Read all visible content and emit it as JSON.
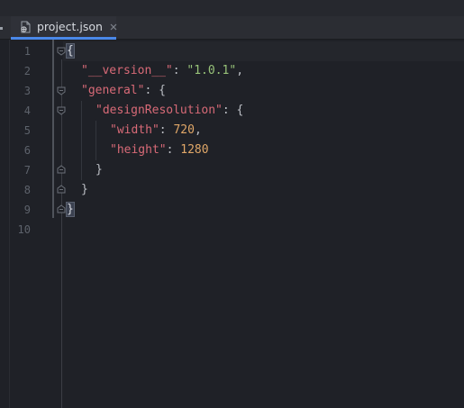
{
  "tab": {
    "icon": "json-file-icon",
    "label": "project.json",
    "close_icon": "close-icon"
  },
  "accent": "#4a88e8",
  "line_numbers": [
    "1",
    "2",
    "3",
    "4",
    "5",
    "6",
    "7",
    "8",
    "9",
    "10"
  ],
  "code": {
    "l1": {
      "brace": "{"
    },
    "l2": {
      "key": "\"__version__\"",
      "colon": ": ",
      "value": "\"1.0.1\"",
      "comma": ","
    },
    "l3": {
      "key": "\"general\"",
      "colon": ": ",
      "brace": "{"
    },
    "l4": {
      "key": "\"designResolution\"",
      "colon": ": ",
      "brace": "{"
    },
    "l5": {
      "key": "\"width\"",
      "colon": ": ",
      "value": "720",
      "comma": ","
    },
    "l6": {
      "key": "\"height\"",
      "colon": ": ",
      "value": "1280"
    },
    "l7": {
      "brace": "}"
    },
    "l8": {
      "brace": "}"
    },
    "l9": {
      "brace": "}"
    }
  },
  "colors": {
    "key": "#d86a77",
    "string": "#98c379",
    "number": "#e0a768",
    "background": "#1f2127"
  }
}
